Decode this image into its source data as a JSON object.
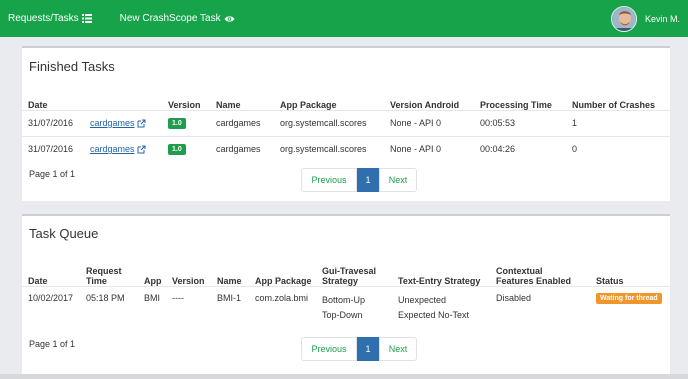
{
  "nav": {
    "requests_label": "Requests/Tasks",
    "new_task_label": "New CrashScope Task",
    "user_name": "Kevin M."
  },
  "finished": {
    "title": "Finished Tasks",
    "headers": [
      "Date",
      "",
      "Version",
      "Name",
      "App Package",
      "Version Android",
      "Processing Time",
      "Number of Crashes"
    ],
    "rows": [
      {
        "date": "31/07/2016",
        "link": "cardgames",
        "version": "1.0",
        "name": "cardgames",
        "package": "org.systemcall.scores",
        "android": "None - API 0",
        "time": "00:05:53",
        "crashes": "1"
      },
      {
        "date": "31/07/2016",
        "link": "cardgames",
        "version": "1.0",
        "name": "cardgames",
        "package": "org.systemcall.scores",
        "android": "None - API 0",
        "time": "00:04:26",
        "crashes": "0"
      }
    ],
    "page_info": "Page 1 of 1",
    "pagination": {
      "prev": "Previous",
      "current": "1",
      "next": "Next"
    }
  },
  "queue": {
    "title": "Task Queue",
    "headers": {
      "date": "Date",
      "request_time_1": "Request",
      "request_time_2": "Time",
      "app": "App",
      "version": "Version",
      "name": "Name",
      "package": "App Package",
      "gui_1": "Gui-Travesal",
      "gui_2": "Strategy",
      "text_entry": "Text-Entry Strategy",
      "contextual_1": "Contextual",
      "contextual_2": "Features Enabled",
      "status": "Status"
    },
    "rows": [
      {
        "date": "10/02/2017",
        "time": "05:18 PM",
        "app": "BMI",
        "version": "----",
        "name": "BMI-1",
        "package": "com.zola.bmi",
        "gui_1": "Bottom-Up",
        "gui_2": "Top-Down",
        "text_1": "Unexpected",
        "text_2": "Expected No-Text",
        "contextual": "Disabled",
        "status": "Wating for thread"
      }
    ],
    "page_info": "Page 1 of 1",
    "pagination": {
      "prev": "Previous",
      "current": "1",
      "next": "Next"
    }
  },
  "colors": {
    "navbar": "#16a34a",
    "badge_green": "#1f9d4d",
    "badge_orange": "#f0962a",
    "page_active": "#2f6fad"
  }
}
